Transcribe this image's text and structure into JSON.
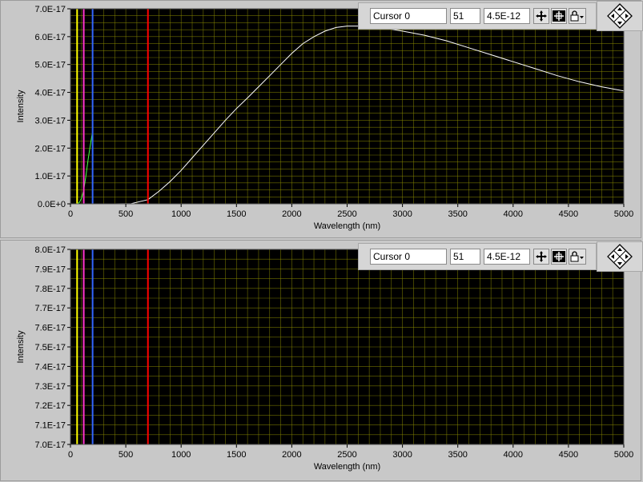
{
  "colors": {
    "plot_bg": "#000000",
    "grid": "#8b8b00",
    "panel_bg": "#c8c8c8",
    "cursor_yellow": "#ffff00",
    "cursor_magenta": "#ff33cc",
    "cursor_blue": "#3366ff",
    "cursor_red": "#ff0000",
    "trace_white": "#ffffff",
    "trace_green": "#44ff44"
  },
  "cursor_legend": {
    "name": "Cursor 0",
    "x_value": "51",
    "y_value": "4.5E-12",
    "icons": [
      "move-cursor-icon",
      "cursor-style-icon",
      "lock-icon",
      "graph-navigation-icon"
    ]
  },
  "chart_data": [
    {
      "type": "line",
      "xlabel": "Wavelength (nm)",
      "ylabel": "Intensity",
      "xlim": [
        0,
        5000
      ],
      "ylim": [
        0,
        7e-17
      ],
      "x_ticks": [
        "0",
        "500",
        "1000",
        "1500",
        "2000",
        "2500",
        "3000",
        "3500",
        "4000",
        "4500",
        "5000"
      ],
      "y_ticks": [
        "0.0E+0",
        "1.0E-17",
        "2.0E-17",
        "3.0E-17",
        "4.0E-17",
        "5.0E-17",
        "6.0E-17",
        "7.0E-17"
      ],
      "grid": true,
      "cursor_lines": [
        {
          "x": 60,
          "color": "#ffff00"
        },
        {
          "x": 120,
          "color": "#ff33cc"
        },
        {
          "x": 200,
          "color": "#3366ff"
        },
        {
          "x": 700,
          "color": "#ff0000"
        }
      ],
      "series": [
        {
          "color": "#ffffff",
          "points": [
            [
              0,
              0
            ],
            [
              400,
              0
            ],
            [
              550,
              1e-19
            ],
            [
              700,
              1.5e-18
            ],
            [
              800,
              4.5e-18
            ],
            [
              900,
              8e-18
            ],
            [
              1000,
              1.2e-17
            ],
            [
              1100,
              1.65e-17
            ],
            [
              1200,
              2.1e-17
            ],
            [
              1300,
              2.55e-17
            ],
            [
              1400,
              3e-17
            ],
            [
              1500,
              3.42e-17
            ],
            [
              1600,
              3.8e-17
            ],
            [
              1700,
              4.2e-17
            ],
            [
              1800,
              4.6e-17
            ],
            [
              1900,
              5e-17
            ],
            [
              2000,
              5.4e-17
            ],
            [
              2100,
              5.75e-17
            ],
            [
              2200,
              6e-17
            ],
            [
              2300,
              6.2e-17
            ],
            [
              2400,
              6.33e-17
            ],
            [
              2500,
              6.38e-17
            ],
            [
              2600,
              6.38e-17
            ],
            [
              2800,
              6.33e-17
            ],
            [
              3000,
              6.2e-17
            ],
            [
              3200,
              6.05e-17
            ],
            [
              3400,
              5.85e-17
            ],
            [
              3600,
              5.6e-17
            ],
            [
              3800,
              5.35e-17
            ],
            [
              4000,
              5.1e-17
            ],
            [
              4200,
              4.85e-17
            ],
            [
              4400,
              4.6e-17
            ],
            [
              4600,
              4.38e-17
            ],
            [
              4800,
              4.2e-17
            ],
            [
              5000,
              4.05e-17
            ]
          ]
        },
        {
          "color": "#44ff44",
          "points": [
            [
              60,
              0
            ],
            [
              80,
              5e-19
            ],
            [
              100,
              2e-18
            ],
            [
              120,
              5e-18
            ],
            [
              140,
              1e-17
            ],
            [
              160,
              1.6e-17
            ],
            [
              175,
              2e-17
            ],
            [
              200,
              2.6e-17
            ]
          ]
        }
      ]
    },
    {
      "type": "line",
      "xlabel": "Wavelength (nm)",
      "ylabel": "Intensity",
      "xlim": [
        0,
        5000
      ],
      "ylim": [
        7e-17,
        8e-17
      ],
      "x_ticks": [
        "0",
        "500",
        "1000",
        "1500",
        "2000",
        "2500",
        "3000",
        "3500",
        "4000",
        "4500",
        "5000"
      ],
      "y_ticks": [
        "7.0E-17",
        "7.1E-17",
        "7.2E-17",
        "7.3E-17",
        "7.4E-17",
        "7.5E-17",
        "7.6E-17",
        "7.7E-17",
        "7.8E-17",
        "7.9E-17",
        "8.0E-17"
      ],
      "grid": true,
      "cursor_lines": [
        {
          "x": 60,
          "color": "#ffff00"
        },
        {
          "x": 120,
          "color": "#ff33cc"
        },
        {
          "x": 200,
          "color": "#3366ff"
        },
        {
          "x": 700,
          "color": "#ff0000"
        }
      ],
      "series": []
    }
  ]
}
